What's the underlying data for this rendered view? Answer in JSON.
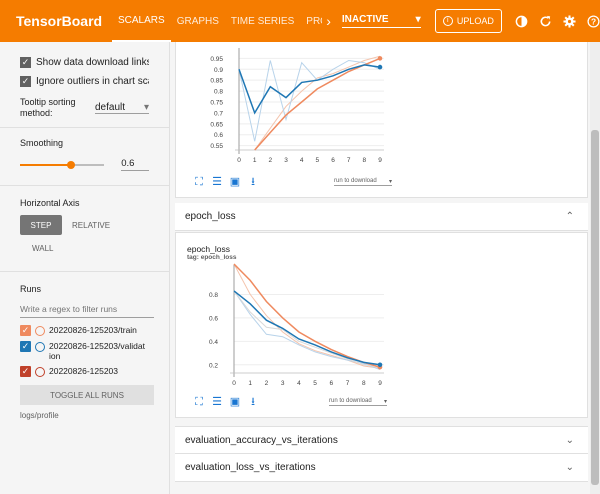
{
  "header": {
    "brand": "TensorBoard",
    "tabs": [
      {
        "label": "SCALARS",
        "active": true
      },
      {
        "label": "GRAPHS",
        "active": false
      },
      {
        "label": "TIME SERIES",
        "active": false
      },
      {
        "label": "PROFI",
        "active": false
      }
    ],
    "run_select": "INACTIVE",
    "upload_label": "UPLOAD",
    "icons": [
      "theme-icon",
      "refresh-icon",
      "settings-icon",
      "help-icon"
    ]
  },
  "sidebar": {
    "show_download": "Show data download links",
    "ignore_outliers": "Ignore outliers in chart scaling",
    "tooltip_label": "Tooltip sorting method:",
    "tooltip_value": "default",
    "smoothing_label": "Smoothing",
    "smoothing_value": "0.6",
    "smoothing_fraction": 0.6,
    "axis_label": "Horizontal Axis",
    "axis_options": [
      "STEP",
      "RELATIVE",
      "WALL"
    ],
    "runs_label": "Runs",
    "filter_placeholder": "Write a regex to filter runs",
    "runs": [
      {
        "name": "20220826-125203/train",
        "color": "#ef8a5f",
        "checked": true
      },
      {
        "name": "20220826-125203/validation",
        "color": "#1f77b4",
        "checked": true
      },
      {
        "name": "20220826-125203",
        "color": "#c0412a",
        "checked": true
      }
    ],
    "toggle_all": "TOGGLE ALL RUNS",
    "logdir": "logs/profile"
  },
  "main": {
    "download_select": "run to download",
    "groups": [
      {
        "label": "epoch_loss",
        "expanded": true
      },
      {
        "label": "evaluation_accuracy_vs_iterations",
        "expanded": false
      },
      {
        "label": "evaluation_loss_vs_iterations",
        "expanded": false
      }
    ]
  },
  "chart_data": [
    {
      "type": "line",
      "title": "",
      "x": [
        0,
        1,
        2,
        3,
        4,
        5,
        6,
        7,
        8,
        9
      ],
      "ylim": [
        0.53,
        0.97
      ],
      "yticks": [
        0.55,
        0.6,
        0.65,
        0.7,
        0.75,
        0.8,
        0.85,
        0.9,
        0.95
      ],
      "xticks": [
        0,
        1,
        2,
        3,
        4,
        5,
        6,
        7,
        8,
        9
      ],
      "series": [
        {
          "name": "20220826-125203/train",
          "color": "#ef8a5f",
          "values": [
            null,
            0.53,
            0.61,
            0.69,
            0.75,
            0.81,
            0.85,
            0.89,
            0.92,
            0.95
          ]
        },
        {
          "name": "20220826-125203/validation",
          "color": "#1f77b4",
          "values": [
            0.9,
            0.7,
            0.82,
            0.77,
            0.84,
            0.85,
            0.87,
            0.9,
            0.92,
            0.91
          ]
        }
      ],
      "raw_series": [
        {
          "color": "#f4c4ad",
          "values": [
            null,
            0.53,
            0.63,
            0.73,
            0.8,
            0.86,
            0.88,
            0.91,
            0.94,
            0.96
          ]
        },
        {
          "color": "#b8d3ea",
          "values": [
            0.9,
            0.57,
            0.94,
            0.67,
            0.93,
            0.85,
            0.9,
            0.94,
            0.93,
            0.9
          ]
        }
      ]
    },
    {
      "type": "line",
      "title": "epoch_loss",
      "tag": "tag: epoch_loss",
      "x": [
        0,
        1,
        2,
        3,
        4,
        5,
        6,
        7,
        8,
        9
      ],
      "ylim": [
        0.13,
        1.0
      ],
      "yticks": [
        0.2,
        0.4,
        0.6,
        0.8
      ],
      "xticks": [
        0,
        1,
        2,
        3,
        4,
        5,
        6,
        7,
        8,
        9
      ],
      "series": [
        {
          "name": "20220826-125203/train",
          "color": "#ef8a5f",
          "values": [
            1.06,
            0.92,
            0.74,
            0.6,
            0.48,
            0.4,
            0.33,
            0.27,
            0.22,
            0.18
          ]
        },
        {
          "name": "20220826-125203/validation",
          "color": "#1f77b4",
          "values": [
            0.83,
            0.72,
            0.58,
            0.51,
            0.42,
            0.37,
            0.31,
            0.26,
            0.22,
            0.2
          ]
        }
      ],
      "raw_series": [
        {
          "color": "#f4c4ad",
          "values": [
            1.06,
            0.8,
            0.62,
            0.48,
            0.38,
            0.32,
            0.28,
            0.24,
            0.19,
            0.17
          ]
        },
        {
          "color": "#b8d3ea",
          "values": [
            0.83,
            0.63,
            0.46,
            0.44,
            0.37,
            0.31,
            0.27,
            0.24,
            0.21,
            0.16
          ]
        },
        {
          "color": "#d9d9d9",
          "values": [
            0.83,
            0.65,
            0.52,
            0.5,
            0.4,
            0.35,
            0.3,
            0.25,
            0.2,
            0.18
          ]
        }
      ]
    }
  ]
}
